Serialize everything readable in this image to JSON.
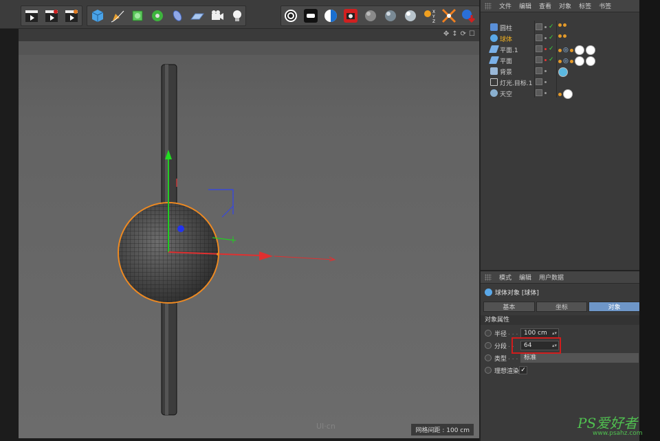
{
  "outliner": {
    "menu": [
      "文件",
      "编辑",
      "查看",
      "对象",
      "标签",
      "书签"
    ],
    "objects": [
      {
        "name": "圆柱",
        "color": "#cfcfcf",
        "icon": "cylinder-icon",
        "tag": "phong-tag"
      },
      {
        "name": "球体",
        "color": "#f0b020",
        "icon": "sphere-icon",
        "tag": "phong-tag"
      },
      {
        "name": "平面.1",
        "color": "#cfcfcf",
        "icon": "plane-icon",
        "tag": "material-tags"
      },
      {
        "name": "平面",
        "color": "#cfcfcf",
        "icon": "plane-icon",
        "tag": "material-tags"
      },
      {
        "name": "背景",
        "color": "#cfcfcf",
        "icon": "background-icon",
        "tag": "material-ball"
      },
      {
        "name": "灯光.目标.1",
        "color": "#cfcfcf",
        "icon": "light-icon",
        "tag": ""
      },
      {
        "name": "天空",
        "color": "#cfcfcf",
        "icon": "sky-icon",
        "tag": "material-ball"
      }
    ]
  },
  "attributes": {
    "menu": [
      "模式",
      "编辑",
      "用户数据"
    ],
    "title": "球体对象 [球体]",
    "tabs": [
      "基本",
      "坐标",
      "对象"
    ],
    "active_tab": "对象",
    "section": "对象属性",
    "props": [
      {
        "label": "半径",
        "dots": ". . .",
        "value": "100 cm"
      },
      {
        "label": "分段",
        "dots": ". .",
        "value": "64"
      },
      {
        "label": "类型",
        "dots": ". . .",
        "value": "标准"
      },
      {
        "label": "理想渲染",
        "dots": "",
        "value": "✓"
      }
    ]
  },
  "viewport": {
    "grid_spacing": "网格间距 : 100 cm",
    "watermark": "UI·cn",
    "header_icons": [
      "move-view-icon",
      "zoom-view-icon",
      "rotate-view-icon",
      "maximize-view-icon"
    ]
  },
  "branding": {
    "ps_text": "PS爱好者",
    "ps_url": "www.psahz.com"
  }
}
